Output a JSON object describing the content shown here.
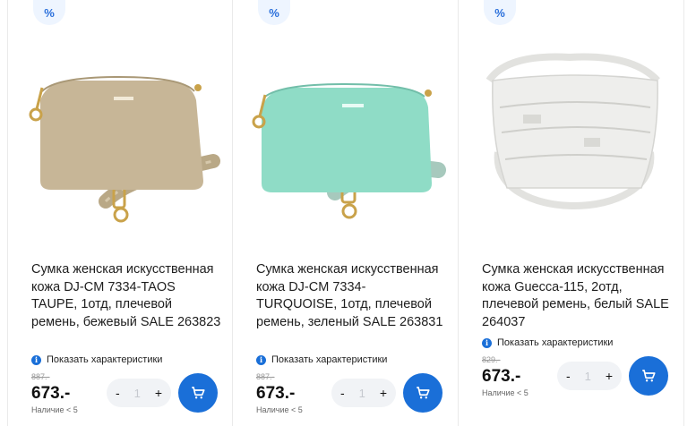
{
  "products": [
    {
      "badge": "%",
      "image": "beige-crossbody-bag",
      "title": "Сумка женская искусственная кожа DJ-CM 7334-TAOS TAUPE, 1отд, плечевой ремень, бежевый SALE 263823",
      "show_chars": "Показать характеристики",
      "old_price": "887.-",
      "price": "673.-",
      "availability": "Наличие < 5",
      "qty": "1",
      "minus": "-",
      "plus": "+",
      "color": "#c9b89a"
    },
    {
      "badge": "%",
      "image": "turquoise-crossbody-bag",
      "title": "Сумка женская искусственная кожа DJ-CM 7334-TURQUOISE, 1отд, плечевой ремень, зеленый SALE 263831",
      "show_chars": "Показать характеристики",
      "old_price": "887.-",
      "price": "673.-",
      "availability": "Наличие < 5",
      "qty": "1",
      "minus": "-",
      "plus": "+",
      "color": "#8fd9c4"
    },
    {
      "badge": "%",
      "image": "white-leather-shoulder-bag",
      "title": "Сумка женская искусственная кожа Guecca-115, 2отд, плечевой ремень, белый SALE 264037",
      "show_chars": "Показать характеристики",
      "old_price": "829.-",
      "price": "673.-",
      "availability": "Наличие < 5",
      "qty": "1",
      "minus": "-",
      "plus": "+",
      "color": "#eeeeec"
    }
  ],
  "accent": "#1a6fd8"
}
